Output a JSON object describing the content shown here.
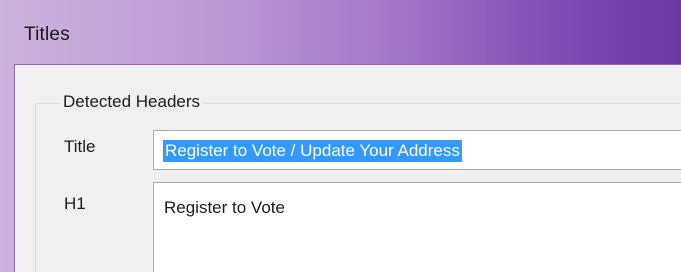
{
  "window": {
    "title": "Titles"
  },
  "group": {
    "label": "Detected Headers"
  },
  "fields": {
    "title_label": "Title",
    "title_value": "Register to Vote / Update Your Address",
    "h1_label": "H1",
    "h1_value": "Register to Vote"
  },
  "colors": {
    "selection": "#3399ff",
    "title_bar_accent": "#7c47b1"
  }
}
